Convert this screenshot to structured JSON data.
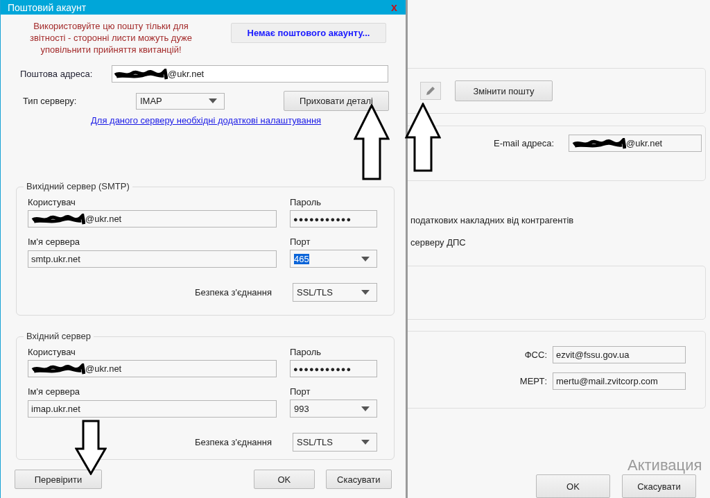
{
  "dialog": {
    "title": "Поштовий акаунт",
    "close": "x",
    "warning": "Використовуйте цю пошту тільки для звітності - сторонні листи можуть дуже уповільнити прийняття квитанцій!",
    "no_account_button": "Немає поштового акаунту...",
    "email": {
      "label": "Поштова адреса:",
      "value": "@ukr.net"
    },
    "server_type": {
      "label": "Тип серверу:",
      "value": "IMAP"
    },
    "details_button": "Приховати деталі",
    "settings_link": "Для даного серверу необхідні додаткові налаштування",
    "servers": [
      {
        "title": "Вихідний сервер (SMTP)",
        "user_label": "Користувач",
        "user": "@ukr.net",
        "password_label": "Пароль",
        "password": "●●●●●●●●●●●",
        "server_label": "Ім'я сервера",
        "server": "smtp.ukr.net",
        "port_label": "Порт",
        "port": "465",
        "port_text_selected": true,
        "security_label": "Безпека з'єднання",
        "security": "SSL/TLS"
      },
      {
        "title": "Вхідний сервер",
        "user_label": "Користувач",
        "user": "@ukr.net",
        "password_label": "Пароль",
        "password": "●●●●●●●●●●●",
        "server_label": "Ім'я сервера",
        "server": "imap.ukr.net",
        "port_label": "Порт",
        "port": "993",
        "port_text_selected": false,
        "security_label": "Безпека з'єднання",
        "security": "SSL/TLS"
      }
    ],
    "buttons": [
      {
        "label": "Перевірити",
        "kind": "left"
      },
      {
        "label": "OK",
        "kind": "right"
      },
      {
        "label": "Скасувати",
        "kind": "right"
      }
    ]
  },
  "background": {
    "change_mail_button": "Змінити пошту",
    "email": {
      "label": "E-mail адреса:",
      "value": "@ukr.net"
    },
    "text_lines": [
      "податкових накладних від контрагентів",
      "серверу ДПС"
    ],
    "recipients": [
      {
        "label": "ФСС:",
        "value": "ezvit@fssu.gov.ua"
      },
      {
        "label": "МЕРТ:",
        "value": "mertu@mail.zvitcorp.com"
      }
    ],
    "buttons": [
      "OK",
      "Скасувати"
    ]
  },
  "os_notice": [
    "Активация"
  ]
}
